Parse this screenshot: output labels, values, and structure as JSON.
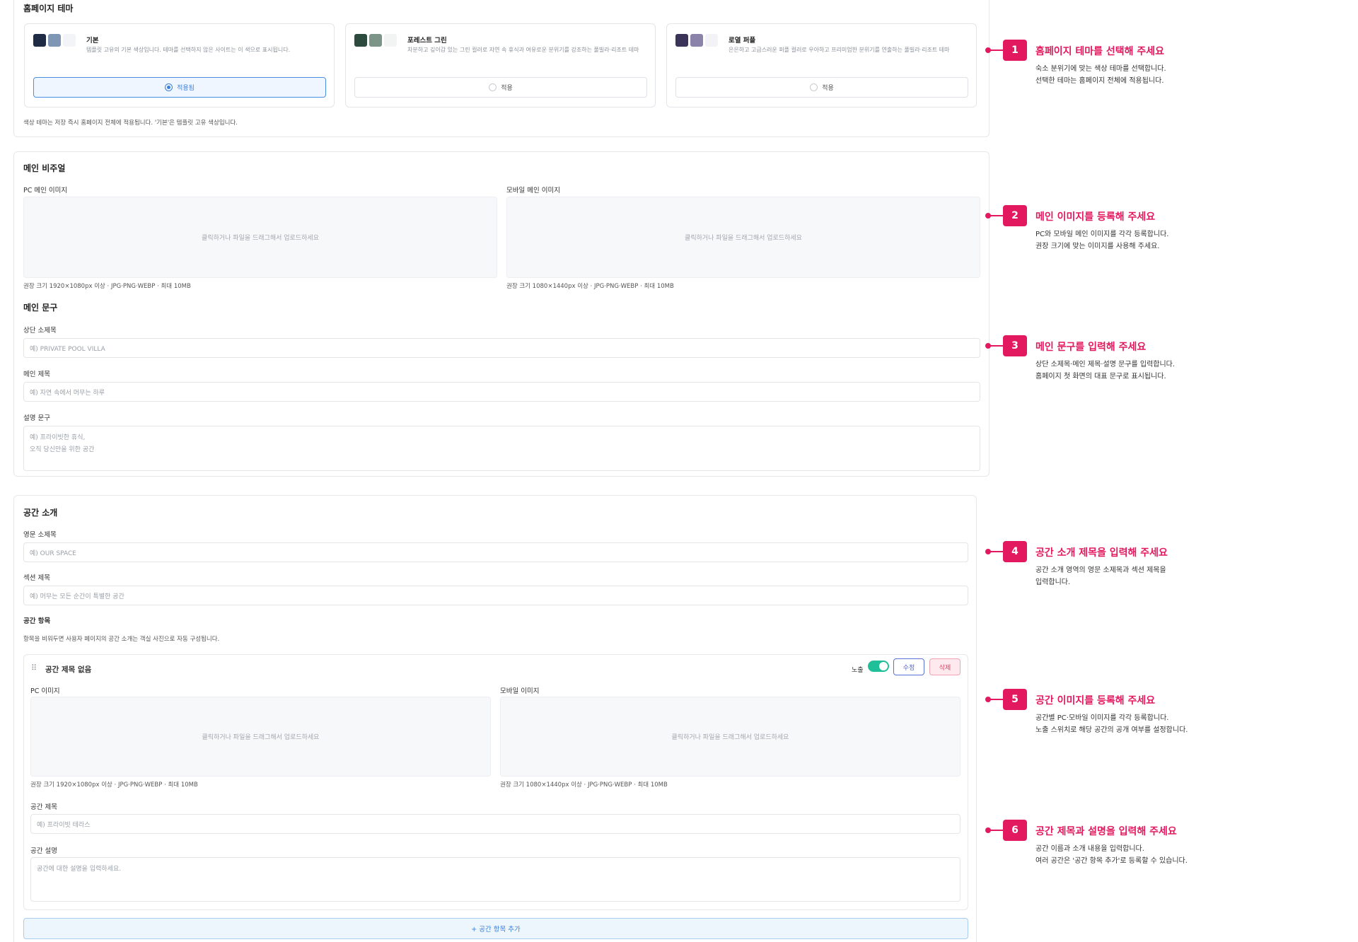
{
  "theme_section": {
    "title": "홈페이지 테마",
    "themes": [
      {
        "name": "기본",
        "description": "템플릿 고유의 기본 색상입니다. 테마를 선택하지 않은 사이트는 이 색으로 표시됩니다.",
        "button_label": "적용됨",
        "selected": true,
        "swatches": [
          "#1f2a44",
          "#7f96b5",
          "#f2f4f7"
        ]
      },
      {
        "name": "포레스트 그린",
        "description": "차분하고 깊이감 있는 그린 컬러로 자연 속 휴식과 여유로운 분위기를 강조하는 풀빌라·리조트 테마",
        "button_label": "적용",
        "selected": false,
        "swatches": [
          "#2c4a3e",
          "#7d9488",
          "#f2f4f3"
        ]
      },
      {
        "name": "로열 퍼플",
        "description": "은은하고 고급스러운 퍼플 컬러로 우아하고 프리미엄한 분위기를 연출하는 풀빌라·리조트 테마",
        "button_label": "적용",
        "selected": false,
        "swatches": [
          "#3b3358",
          "#8c83aa",
          "#f3f2f6"
        ]
      }
    ],
    "note": "색상 테마는 저장 즉시 홈페이지 전체에 적용됩니다. '기본'은 템플릿 고유 색상입니다."
  },
  "main_visual": {
    "title": "메인 비주얼",
    "pc_label": "PC 메인 이미지",
    "mobile_label": "모바일 메인 이미지",
    "dropzone_text": "클릭하거나 파일을 드래그해서 업로드하세요",
    "pc_hint": "권장 크기 1920×1080px 이상 · JPG·PNG·WEBP · 최대 10MB",
    "mobile_hint": "권장 크기 1080×1440px 이상 · JPG·PNG·WEBP · 최대 10MB"
  },
  "main_copy": {
    "title": "메인 문구",
    "subtitle_label": "상단 소제목",
    "subtitle_placeholder": "예) PRIVATE POOL VILLA",
    "heading_label": "메인 제목",
    "heading_placeholder": "예) 자연 속에서 머무는 하루",
    "desc_label": "설명 문구",
    "desc_placeholder": "예) 프라이빗한 휴식,\n오직 당신만을 위한 공간"
  },
  "space_intro": {
    "title": "공간 소개",
    "eng_label": "영문 소제목",
    "eng_placeholder": "예) OUR SPACE",
    "section_label": "섹션 제목",
    "section_placeholder": "예) 머무는 모든 순간이 특별한 공간",
    "items_label": "공간 항목",
    "items_hint": "항목을 비워두면 사용자 페이지의 공간 소개는 객실 사진으로 자동 구성됩니다.",
    "item": {
      "title": "공간 제목 없음",
      "visible_label": "노출",
      "visible": true,
      "edit_label": "수정",
      "delete_label": "삭제",
      "pc_label": "PC 이미지",
      "mobile_label": "모바일 이미지",
      "dropzone_text": "클릭하거나 파일을 드래그해서 업로드하세요",
      "pc_hint": "권장 크기 1920×1080px 이상 · JPG·PNG·WEBP · 최대 10MB",
      "mobile_hint": "권장 크기 1080×1440px 이상 · JPG·PNG·WEBP · 최대 10MB",
      "name_label": "공간 제목",
      "name_placeholder": "예) 프라이빗 테라스",
      "desc_label": "공간 설명",
      "desc_placeholder": "공간에 대한 설명을 입력하세요."
    },
    "add_label": "+ 공간 항목 추가"
  },
  "callouts": [
    {
      "number": "1",
      "title": "홈페이지 테마를 선택해 주세요",
      "desc": "숙소 분위기에 맞는 색상 테마를 선택합니다.\n선택한 테마는 홈페이지 전체에 적용됩니다."
    },
    {
      "number": "2",
      "title": "메인 이미지를 등록해 주세요",
      "desc": "PC와 모바일 메인 이미지를 각각 등록합니다.\n권장 크기에 맞는 이미지를 사용해 주세요."
    },
    {
      "number": "3",
      "title": "메인 문구를 입력해 주세요",
      "desc": "상단 소제목·메인 제목·설명 문구를 입력합니다.\n홈페이지 첫 화면의 대표 문구로 표시됩니다."
    },
    {
      "number": "4",
      "title": "공간 소개 제목을 입력해 주세요",
      "desc": "공간 소개 영역의 영문 소제목과 섹션 제목을\n입력합니다."
    },
    {
      "number": "5",
      "title": "공간 이미지를 등록해 주세요",
      "desc": "공간별 PC·모바일 이미지를 각각 등록합니다.\n노출 스위치로 해당 공간의 공개 여부를 설정합니다."
    },
    {
      "number": "6",
      "title": "공간 제목과 설명을 입력해 주세요",
      "desc": "공간 이름과 소개 내용을 입력합니다.\n여러 공간은 '공간 항목 추가'로 등록할 수 있습니다."
    }
  ],
  "colors": {
    "accent": "#e3195f",
    "primary": "#3b7fd6",
    "toggle_on": "#1fbf9a"
  }
}
